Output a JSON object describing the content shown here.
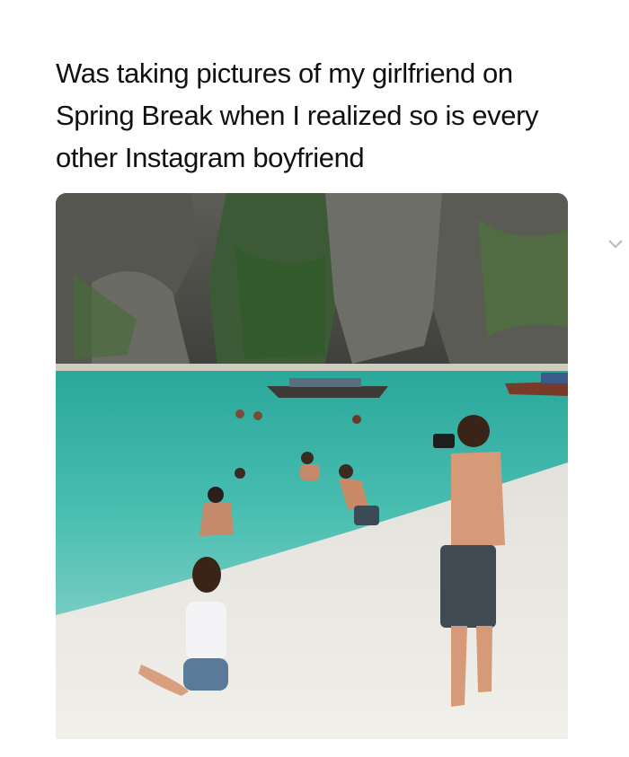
{
  "post": {
    "caption_lines": [
      "Was taking pictures of my girlfriend on",
      "Spring Break when I realized so is every",
      "other Instagram boyfriend"
    ],
    "photo_icon": "beach-photo",
    "expand_icon": "chevron-down-icon"
  },
  "colors": {
    "background": "#ffffff",
    "text": "#111111",
    "water": "#3fb5a8",
    "sand": "#ece9e3",
    "cliff": "#4d4e48"
  }
}
